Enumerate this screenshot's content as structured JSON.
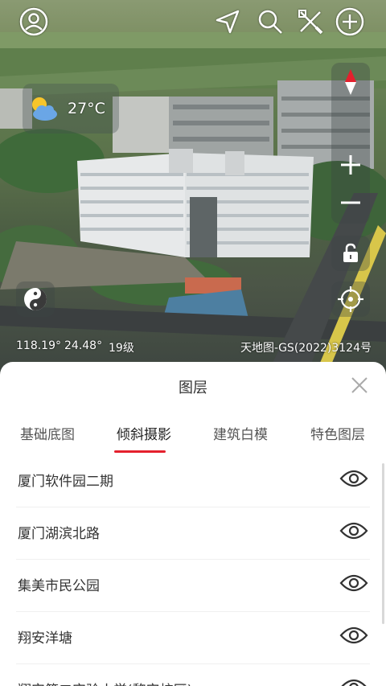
{
  "topbar": {
    "icons": [
      "user-icon",
      "navigate-icon",
      "search-icon",
      "measure-icon",
      "add-icon"
    ]
  },
  "weather": {
    "icon": "partly-cloudy-icon",
    "temperature": "27°C"
  },
  "map_controls": {
    "icons": [
      "compass-icon",
      "zoom-in-icon",
      "zoom-out-icon",
      "lock-icon",
      "yin-yang-icon",
      "locate-icon"
    ]
  },
  "status": {
    "longitude": "118.19°",
    "latitude": "24.48°",
    "zoom": "19级",
    "copyright": "天地图-GS(2022)3124号"
  },
  "sheet": {
    "title": "图层",
    "tabs": [
      "基础底图",
      "倾斜摄影",
      "建筑白模",
      "特色图层"
    ],
    "active_tab": "倾斜摄影",
    "items": [
      {
        "name": "厦门软件园二期"
      },
      {
        "name": "厦门湖滨北路"
      },
      {
        "name": "集美市民公园"
      },
      {
        "name": "翔安洋塘"
      },
      {
        "name": "翔安第二实验小学(黎安校区)"
      }
    ]
  },
  "colors": {
    "accent": "#e4202d",
    "text": "#333333"
  }
}
